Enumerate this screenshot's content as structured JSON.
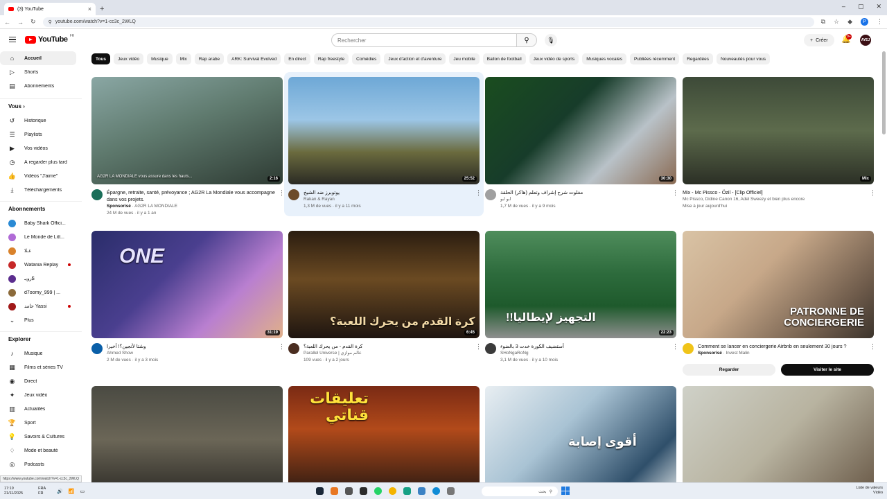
{
  "browser": {
    "tab_title": "(3) YouTube",
    "url": "youtube.com/watch?v=1-cc3c_2WLQ",
    "new_tab": "+",
    "status_url": "https://www.youtube.com/watch?v=1-cc3c_2WLQ"
  },
  "header": {
    "logo_text": "YouTube",
    "country_code": "FR",
    "search_placeholder": "Rechercher",
    "create_label": "Créer",
    "notif_count": "9+",
    "avatar_text": "AYEJ"
  },
  "sidebar": {
    "main": [
      {
        "label": "Accueil",
        "icon": "home-icon",
        "glyph": "⌂",
        "active": true
      },
      {
        "label": "Shorts",
        "icon": "shorts-icon",
        "glyph": "▷"
      },
      {
        "label": "Abonnements",
        "icon": "subscriptions-icon",
        "glyph": "▤"
      }
    ],
    "you_heading": "Vous  ›",
    "you": [
      {
        "label": "Historique",
        "icon": "history-icon",
        "glyph": "↺"
      },
      {
        "label": "Playlists",
        "icon": "playlist-icon",
        "glyph": "☰"
      },
      {
        "label": "Vos vidéos",
        "icon": "your-videos-icon",
        "glyph": "▶"
      },
      {
        "label": "À regarder plus tard",
        "icon": "watch-later-icon",
        "glyph": "◷"
      },
      {
        "label": "Vidéos \"J'aime\"",
        "icon": "like-icon",
        "glyph": "👍"
      },
      {
        "label": "Téléchargements",
        "icon": "download-icon",
        "glyph": "⤓"
      }
    ],
    "subs_heading": "Abonnements",
    "subs": [
      {
        "label": "Baby Shark Offici...",
        "color": "#2a8ad4"
      },
      {
        "label": "Le Monde de Litt...",
        "color": "#b06bd6"
      },
      {
        "label": "غـلا",
        "color": "#d9822b"
      },
      {
        "label": "Watania Replay",
        "color": "#c62828",
        "live": true
      },
      {
        "label": "رويـ$",
        "color": "#5b2d8e"
      },
      {
        "label": "d7oomy_999 | ...",
        "color": "#8b6a3a"
      },
      {
        "label": "حامد Yassi",
        "color": "#a01818",
        "live": true
      },
      {
        "label": "Plus",
        "icon": "more-icon",
        "glyph": "⌄"
      }
    ],
    "explore_heading": "Explorer",
    "explore": [
      {
        "label": "Musique",
        "icon": "music-icon",
        "glyph": "♪"
      },
      {
        "label": "Films et séries TV",
        "icon": "movies-icon",
        "glyph": "▦"
      },
      {
        "label": "Direct",
        "icon": "live-icon",
        "glyph": "◉"
      },
      {
        "label": "Jeux vidéo",
        "icon": "gaming-icon",
        "glyph": "✦"
      },
      {
        "label": "Actualités",
        "icon": "news-icon",
        "glyph": "▥"
      },
      {
        "label": "Sport",
        "icon": "sport-icon",
        "glyph": "🏆"
      },
      {
        "label": "Savoirs & Cultures",
        "icon": "learning-icon",
        "glyph": "💡"
      },
      {
        "label": "Mode et beauté",
        "icon": "fashion-icon",
        "glyph": "♢"
      },
      {
        "label": "Podcasts",
        "icon": "podcast-icon",
        "glyph": "◎"
      }
    ]
  },
  "chips": [
    "Tous",
    "Jeux vidéo",
    "Musique",
    "Mix",
    "Rap arabe",
    "ARK: Survival Evolved",
    "En direct",
    "Rap freestyle",
    "Comédies",
    "Jeux d'action et d'aventure",
    "Jeu mobile",
    "Ballon de football",
    "Jeux vidéo de sports",
    "Musiques vocales",
    "Publiées récemment",
    "Regardées",
    "Nouveautés pour vous"
  ],
  "videos": [
    {
      "title": "Épargne, retraite, santé, prévoyance ; AG2R La Mondiale vous accompagne dans vos projets.",
      "channel": "Sponsorisé · AG2R LA MONDIALE",
      "stats": "24 M de vues · il y a 1 an",
      "duration": "2:16",
      "overlay": "AG2R LA MONDIALE vous assure dans les hauts...",
      "bg": "linear-gradient(160deg,#8aa7a4 0%,#5f7a6e 45%,#2e3b33 100%)",
      "avatar": "#1b6f5a"
    },
    {
      "title": "يوتوبرز ضد الشيخ",
      "channel": "Rakan & Rayan",
      "stats": "1,3 M de vues · il y a 11 mois",
      "duration": "25:52",
      "overlay": "",
      "bg": "linear-gradient(180deg,#6ea8d6 0%,#9cc6e6 40%,#6b6b3e 70%,#2a2a24 100%)",
      "avatar": "#6c4b2a"
    },
    {
      "title": "مغلوت شرح إشراف وتعلم (هاكر) الحلقة",
      "channel": "ابو ابو",
      "stats": "1,7 M de vues · il y a 9 mois",
      "duration": "30:30",
      "overlay": "",
      "bg": "linear-gradient(135deg,#1a4d1f 0%,#173c2a 40%,#b9c2c8 70%,#8a6a52 100%)",
      "avatar": "#a0a0a0"
    },
    {
      "title": "Mix - Mc Pissco - Özil - [Clip Officiel]",
      "channel": "Mc Pissco, Didine Canon 16, Adel Sweezy et bien plus encore",
      "stats": "Mise à jour aujourd'hui",
      "duration": "Mix",
      "overlay": "",
      "bg": "linear-gradient(180deg,#3d4a38 0%,#5d6b4c 50%,#2b2f25 100%)",
      "avatar": ""
    },
    {
      "title": "وشتا لأنجين؟! أخيرا",
      "channel": "Ahmed Show",
      "stats": "2 M de vues · il y a 3 mois",
      "duration": "31:19",
      "overlay": "ONE",
      "bg": "linear-gradient(135deg,#2a2d6a 0%,#4a3f8f 40%,#b97fd0 70%,#e0b08a 100%)",
      "avatar": "#0a5fa8"
    },
    {
      "title": "كرة القدم - من يحرك اللعبة؟",
      "channel": "Parallel Universe | عالم موازي",
      "stats": "109 vues · il y a 2 jours",
      "duration": "6:45",
      "overlay": "كرة القدم من يحرك اللعبة؟",
      "bg": "linear-gradient(180deg,#2b1d10 0%,#6b4a22 45%,#1e1510 100%)",
      "avatar": "#4a2d20"
    },
    {
      "title": "أستضيف الكورة خدت 3 بالضوء",
      "channel": "SHoNgaRoNg",
      "stats": "3,1 M de vues · il y a 10 mois",
      "duration": "22:23",
      "overlay": "التجهيز لإيطاليا!!",
      "bg": "linear-gradient(180deg,#4f8d5c 0%,#2d6b3c 40%,#1e5a2c 70%,#8f8f8f 100%)",
      "avatar": "#3b3b3b"
    },
    {
      "title": "Comment se lancer en conciergerie Airbnb en seulement 30 jours ?",
      "channel": "Sponsorisé · Invest Malin",
      "stats": "",
      "duration": "",
      "overlay": "PATRONNE DE CONCIERGERIE",
      "bg": "linear-gradient(135deg,#d9c3a5 0%,#c7a889 40%,#6d5a4a 80%,#3c342c 100%)",
      "avatar": "#f0c419"
    },
    {
      "title": "",
      "channel": "",
      "stats": "",
      "duration": "",
      "overlay": "",
      "bg": "linear-gradient(180deg,#4a4a42 0%,#6b6657 50%,#2f2d28 100%)",
      "avatar": ""
    },
    {
      "title": "",
      "channel": "",
      "stats": "",
      "duration": "",
      "overlay": "تعليقات قناتي",
      "bg": "linear-gradient(180deg,#7a2a14 0%,#b24a1a 40%,#2b1a12 100%)",
      "avatar": ""
    },
    {
      "title": "",
      "channel": "",
      "stats": "",
      "duration": "",
      "overlay": "أقوى إصابة",
      "bg": "linear-gradient(135deg,#e8eef2 0%,#a9c3d4 40%,#2f4f6a 80%,#d0d8dc 100%)",
      "avatar": ""
    },
    {
      "title": "",
      "channel": "",
      "stats": "",
      "duration": "",
      "overlay": "",
      "bg": "linear-gradient(135deg,#cfd1c8 0%,#b8b3a0 50%,#6a5a48 100%)",
      "avatar": ""
    }
  ],
  "ad": {
    "watch": "Regarder",
    "visit": "Visiter le site"
  },
  "taskbar": {
    "time": "17:19",
    "date": "21/11/2025",
    "lang1": "FRA",
    "lang2": "FR",
    "search_text": "بحث",
    "right1": "Liste de valeurs",
    "right2": "Vidéo"
  }
}
